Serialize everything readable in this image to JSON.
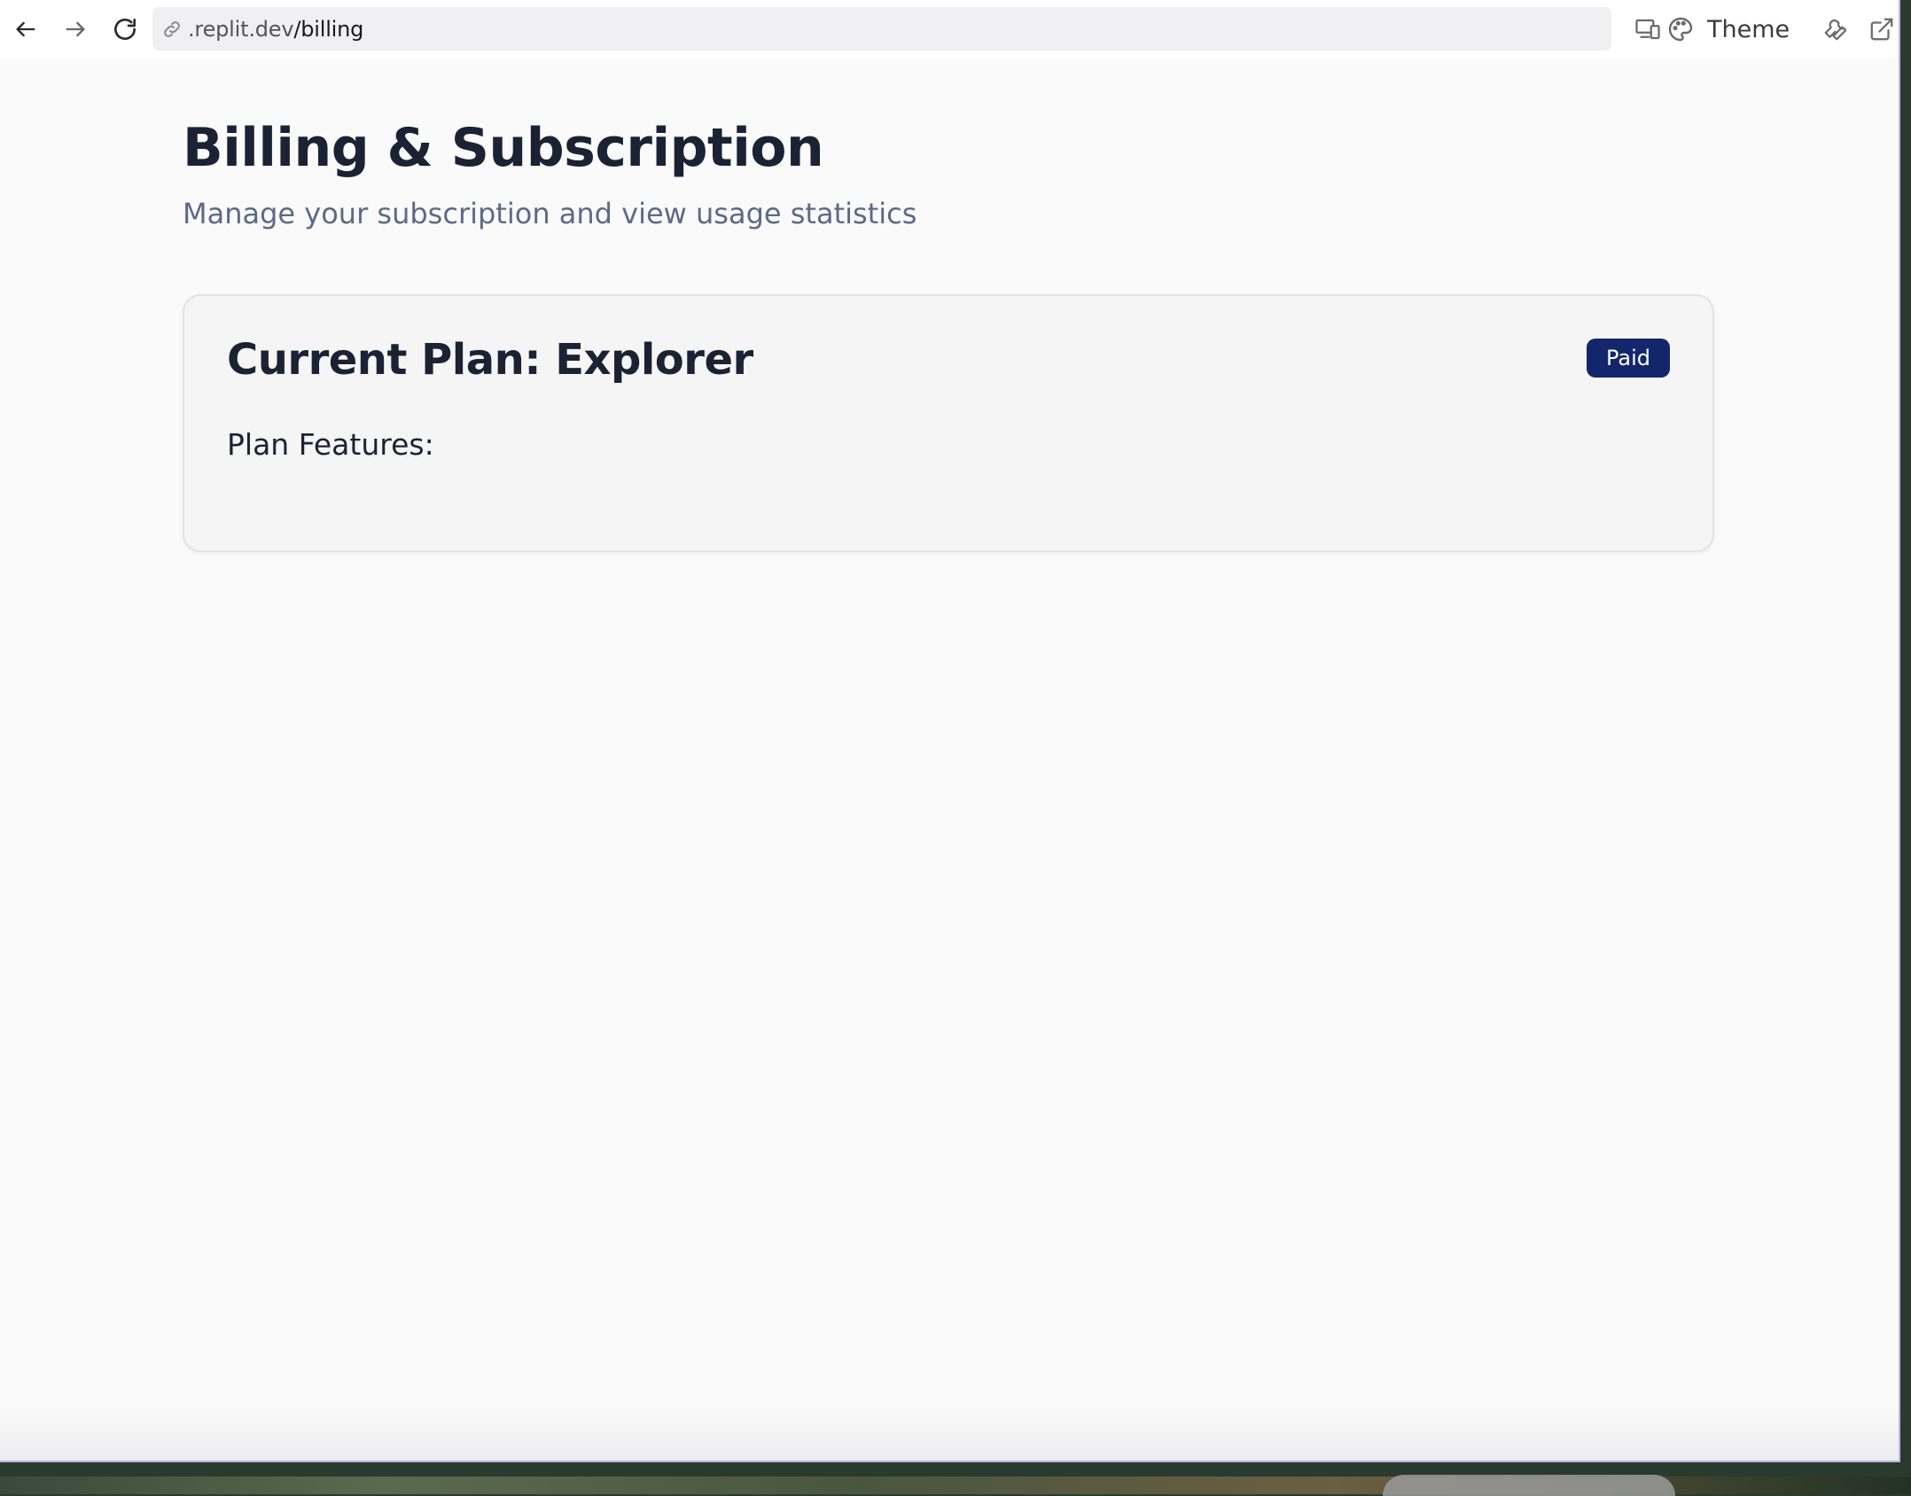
{
  "browser": {
    "url_host": ".replit.dev",
    "url_path": "/billing",
    "theme_label": "Theme"
  },
  "page": {
    "title": "Billing & Subscription",
    "subtitle": "Manage your subscription and view usage statistics"
  },
  "plan_card": {
    "title": "Current Plan: Explorer",
    "badge": "Paid",
    "features_label": "Plan Features:"
  },
  "colors": {
    "badge_bg": "#14266b",
    "title": "#1b2233",
    "subtitle": "#5c6a85",
    "page_bg": "#fafafa"
  },
  "icons": [
    "back-arrow-icon",
    "forward-arrow-icon",
    "reload-icon",
    "link-icon",
    "devices-icon",
    "palette-icon",
    "wrench-icon",
    "external-link-icon"
  ]
}
